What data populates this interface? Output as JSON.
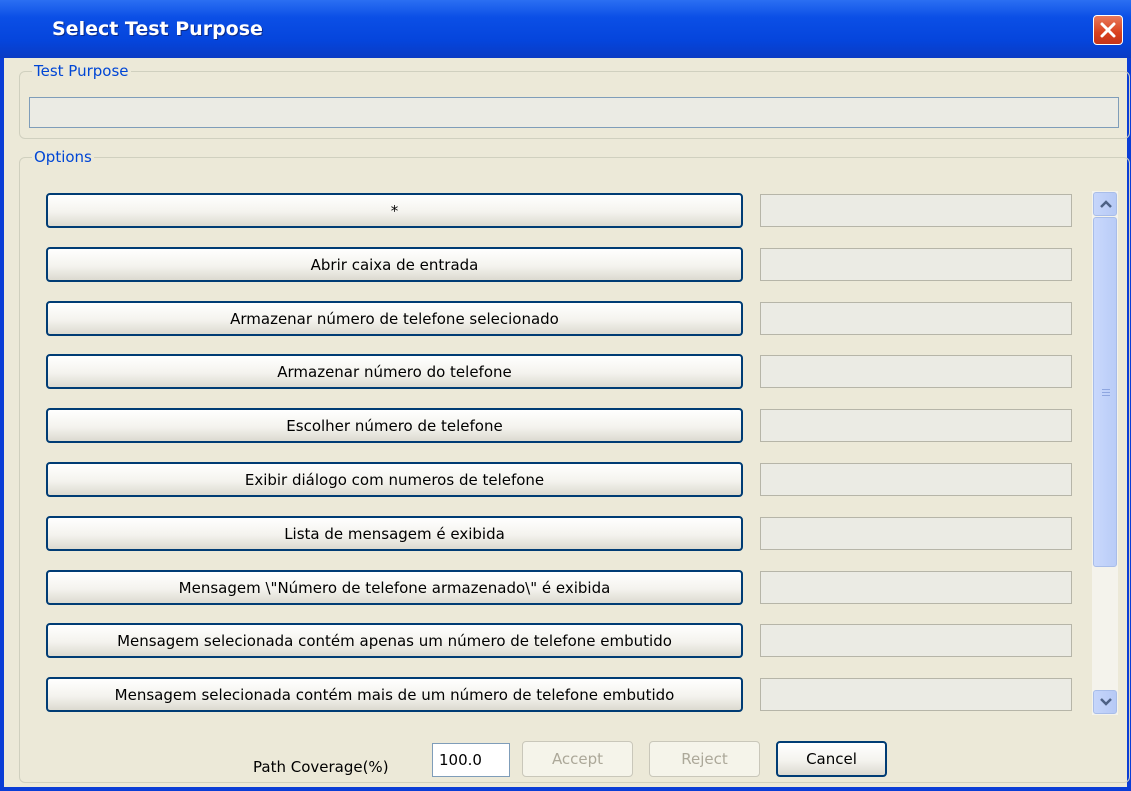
{
  "window": {
    "title": "Select Test Purpose",
    "close_icon": "close-icon"
  },
  "test_purpose": {
    "legend": "Test Purpose",
    "value": ""
  },
  "options": {
    "legend": "Options",
    "items": [
      {
        "label": "*",
        "value": ""
      },
      {
        "label": "Abrir caixa de entrada",
        "value": ""
      },
      {
        "label": "Armazenar número de telefone selecionado",
        "value": ""
      },
      {
        "label": "Armazenar número do telefone",
        "value": ""
      },
      {
        "label": "Escolher número de telefone",
        "value": ""
      },
      {
        "label": "Exibir diálogo com numeros de telefone",
        "value": ""
      },
      {
        "label": "Lista de mensagem é exibida",
        "value": ""
      },
      {
        "label": "Mensagem \\\"Número de telefone armazenado\\\" é exibida",
        "value": ""
      },
      {
        "label": "Mensagem selecionada contém apenas um número de telefone embutido",
        "value": ""
      },
      {
        "label": "Mensagem selecionada contém mais de um número de telefone embutido",
        "value": ""
      }
    ]
  },
  "footer": {
    "coverage_label": "Path Coverage(%)",
    "coverage_value": "100.0",
    "accept_label": "Accept",
    "reject_label": "Reject",
    "cancel_label": "Cancel"
  },
  "colors": {
    "title_bar": "#0b4fe6",
    "legend_text": "#0046d5",
    "dialog_bg": "#ece9d8",
    "close_button": "#d9411e"
  }
}
